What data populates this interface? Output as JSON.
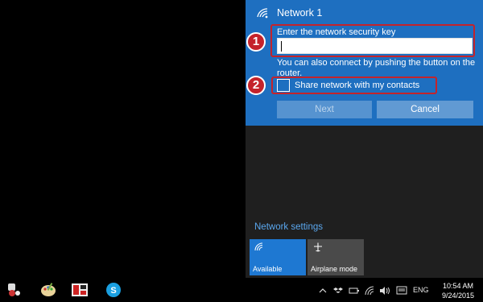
{
  "network": {
    "name": "Network 1",
    "key_label": "Enter the network security key",
    "key_value": "",
    "router_note": "You can also connect by pushing the button on the router.",
    "share_label": "Share network with my contacts",
    "share_checked": false,
    "next_label": "Next",
    "cancel_label": "Cancel"
  },
  "annotations": [
    "1",
    "2"
  ],
  "settings_link": "Network settings",
  "quick_actions": [
    {
      "label": "Available",
      "icon": "wifi-icon"
    },
    {
      "label": "Airplane mode",
      "icon": "airplane-icon"
    }
  ],
  "taskbar": {
    "apps": [
      {
        "name": "network-tool-icon"
      },
      {
        "name": "paint-icon"
      },
      {
        "name": "media-app-icon"
      },
      {
        "name": "skype-icon"
      }
    ],
    "tray": {
      "language": "ENG"
    },
    "time": "10:54 AM",
    "date": "9/24/2015"
  },
  "colors": {
    "accent": "#1e6fc0",
    "annotation": "#c4232b",
    "link": "#5aa7ee",
    "flyout_bg": "#1f1f1f"
  }
}
